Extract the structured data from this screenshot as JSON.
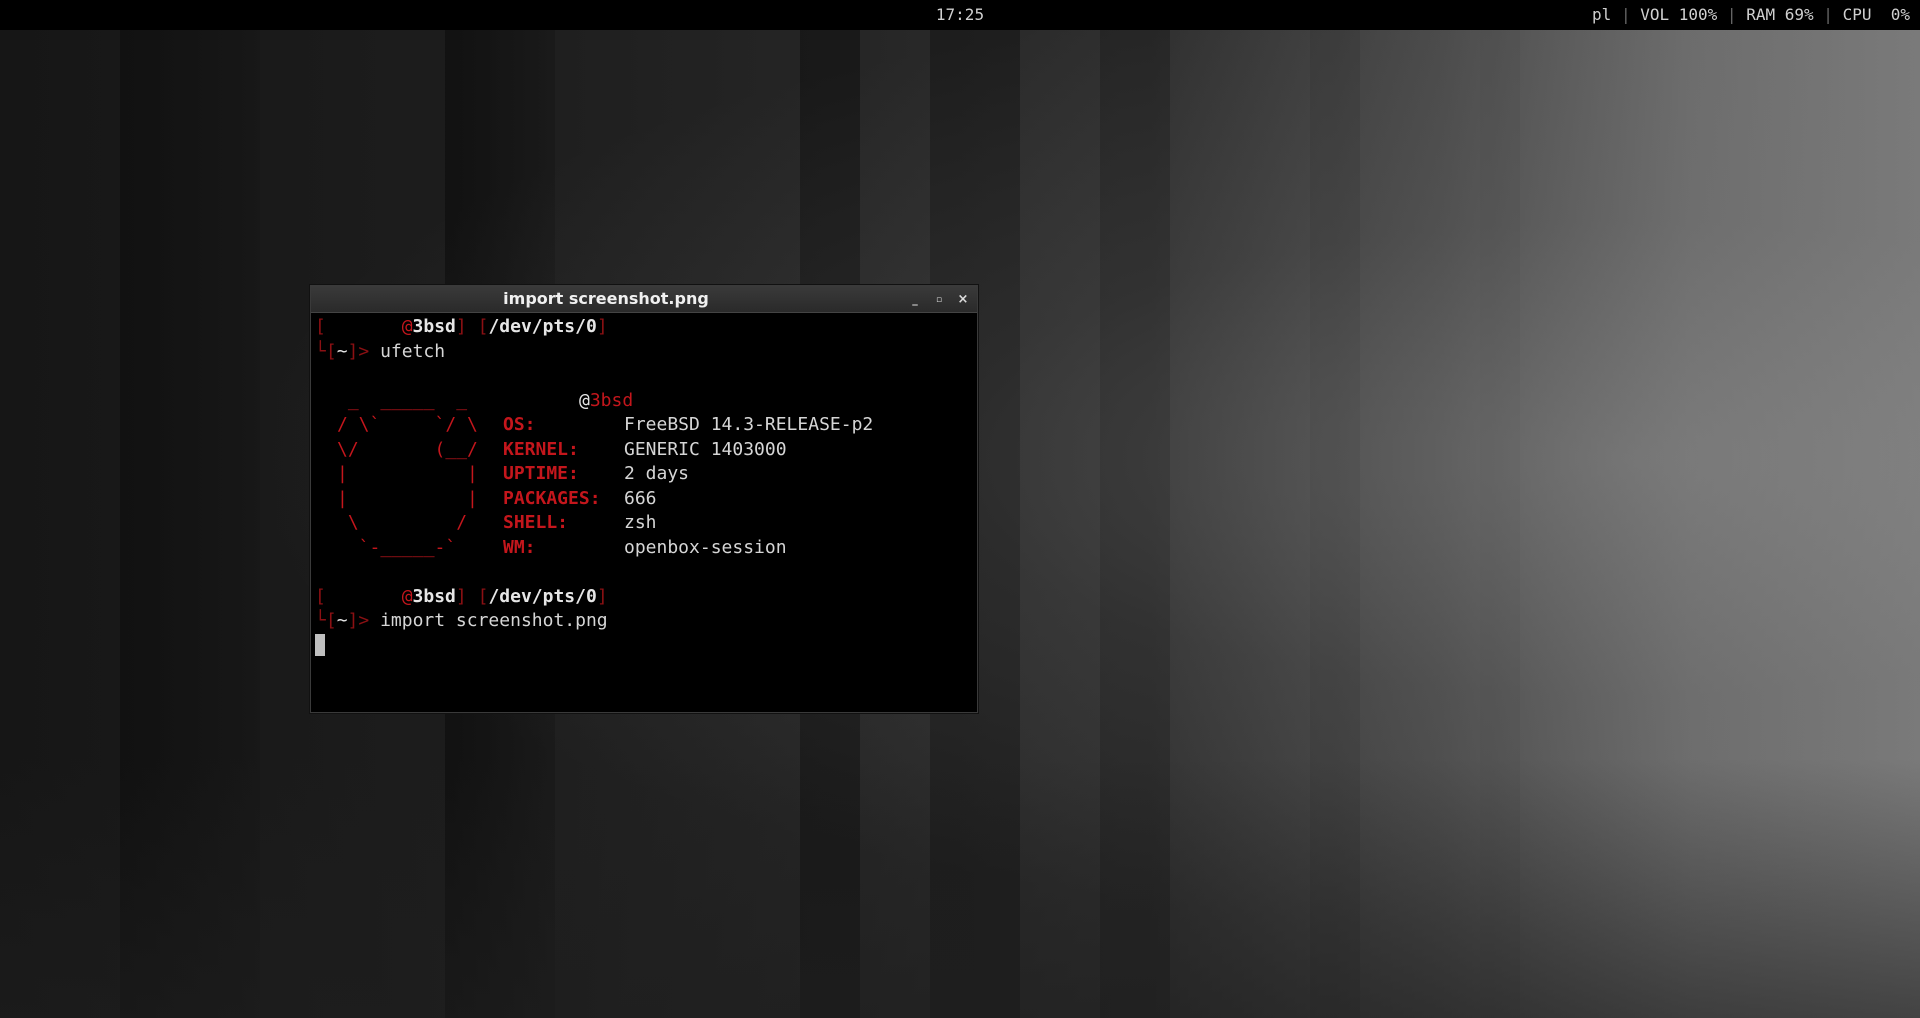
{
  "topbar": {
    "clock": "17:25",
    "layout": "pl",
    "vol_label": "VOL",
    "vol_value": "100%",
    "ram_label": "RAM",
    "ram_value": "69%",
    "cpu_label": "CPU",
    "cpu_value": "0%"
  },
  "window": {
    "title": "import screenshot.png",
    "buttons": {
      "minimize": "_",
      "maximize": "▫",
      "close": "×"
    }
  },
  "terminal": {
    "prompt1": {
      "open": "[",
      "at": "@",
      "host": "3bsd",
      "close": "]",
      "tty_open": "[",
      "tty": "/dev/pts/0",
      "tty_close": "]",
      "cwd_open": "[",
      "cwd": "~",
      "cwd_close": "]",
      "arrow": ">",
      "command": "ufetch"
    },
    "ufetch": {
      "host_at": "@",
      "host": "3bsd",
      "ascii": [
        " _  _____  _",
        "/ \\`     `/ \\",
        "\\/       (__/",
        "|           |",
        "|           |",
        " \\         /",
        "  `-_____-`"
      ],
      "rows": [
        {
          "key": "OS:",
          "value": "FreeBSD 14.3-RELEASE-p2"
        },
        {
          "key": "KERNEL:",
          "value": "GENERIC 1403000"
        },
        {
          "key": "UPTIME:",
          "value": "2 days"
        },
        {
          "key": "PACKAGES:",
          "value": "666"
        },
        {
          "key": "SHELL:",
          "value": "zsh"
        },
        {
          "key": "WM:",
          "value": "openbox-session"
        }
      ]
    },
    "prompt2": {
      "open": "[",
      "at": "@",
      "host": "3bsd",
      "close": "]",
      "tty_open": "[",
      "tty": "/dev/pts/0",
      "tty_close": "]",
      "cwd_open": "[",
      "cwd": "~",
      "cwd_close": "]",
      "arrow": ">",
      "command": "import screenshot.png"
    }
  }
}
